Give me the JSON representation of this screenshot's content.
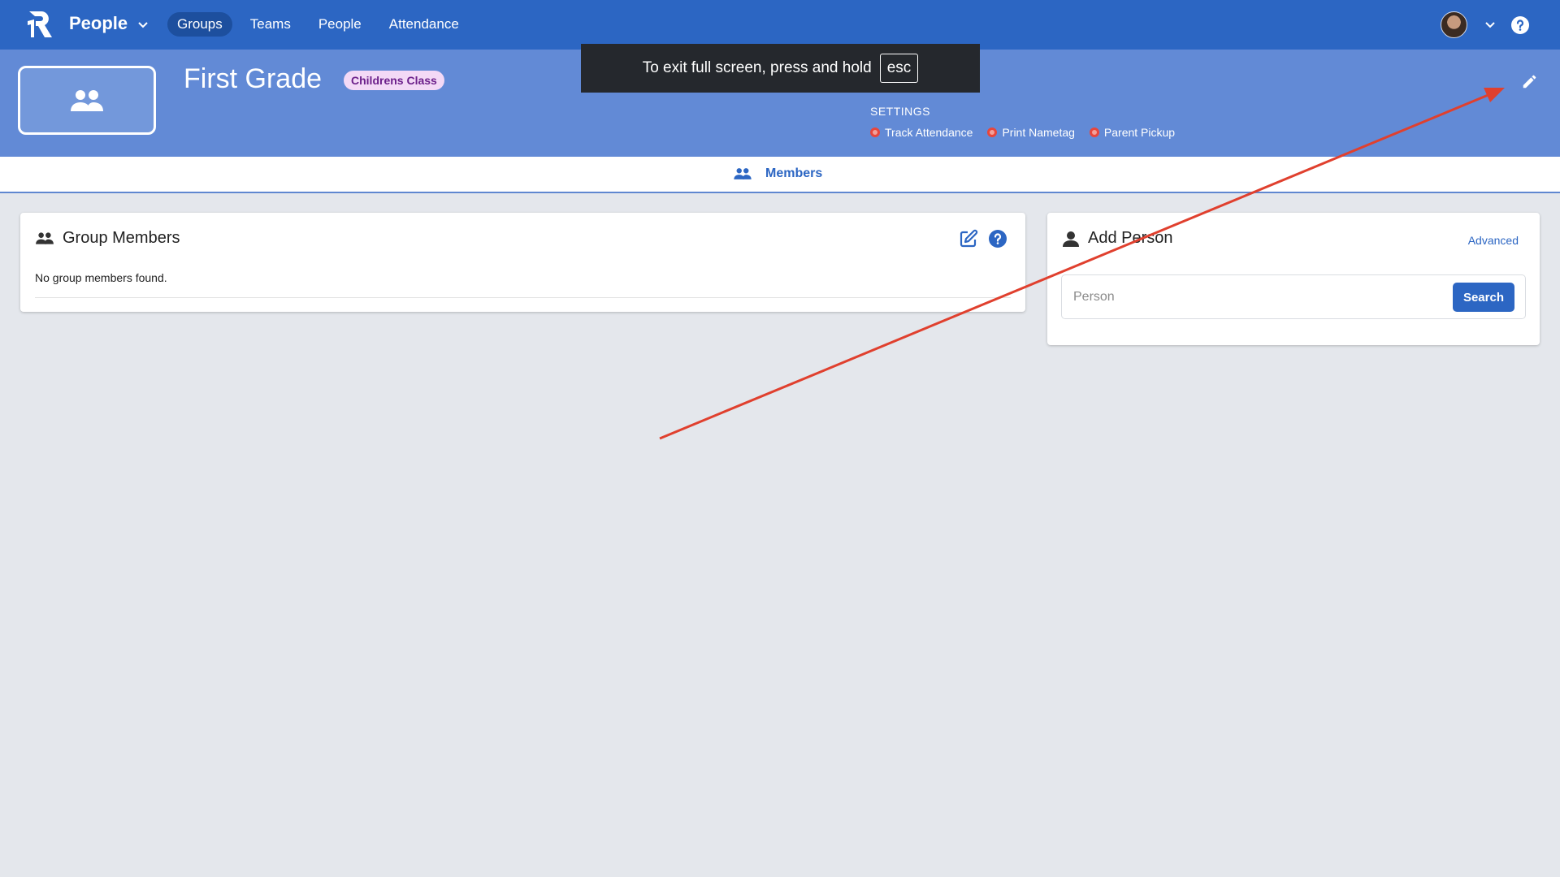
{
  "app": {
    "name": "People",
    "nav": [
      "Groups",
      "Teams",
      "People",
      "Attendance"
    ],
    "active_nav": "Groups"
  },
  "toast": {
    "text": "To exit full screen, press and hold",
    "key": "esc"
  },
  "group": {
    "name": "First Grade",
    "category": "Childrens Class",
    "settings_label": "SETTINGS",
    "settings": [
      "Track Attendance",
      "Print Nametag",
      "Parent Pickup"
    ]
  },
  "tabs": {
    "members": "Members"
  },
  "members_card": {
    "title": "Group Members",
    "empty_text": "No group members found."
  },
  "add_person_card": {
    "title": "Add Person",
    "advanced_label": "Advanced",
    "search_placeholder": "Person",
    "search_button": "Search"
  },
  "colors": {
    "primary": "#2c66c3",
    "banner": "#628ad6",
    "badge_bg": "#f3d9f6",
    "badge_text": "#6b1f8a",
    "setting_off": "#e8463b",
    "annotation_arrow": "#e0402e",
    "page_bg": "#e4e7ec"
  },
  "icons": {
    "logo": "b1-logo-icon",
    "app_chevron": "chevron-down-icon",
    "avatar_chevron": "chevron-down-icon",
    "help": "help-circle-icon",
    "group_photo": "people-icon",
    "edit_group": "pencil-icon",
    "members_tab": "people-icon",
    "members_header": "people-icon",
    "members_edit": "edit-square-icon",
    "members_help": "help-circle-icon",
    "add_person": "person-icon"
  }
}
